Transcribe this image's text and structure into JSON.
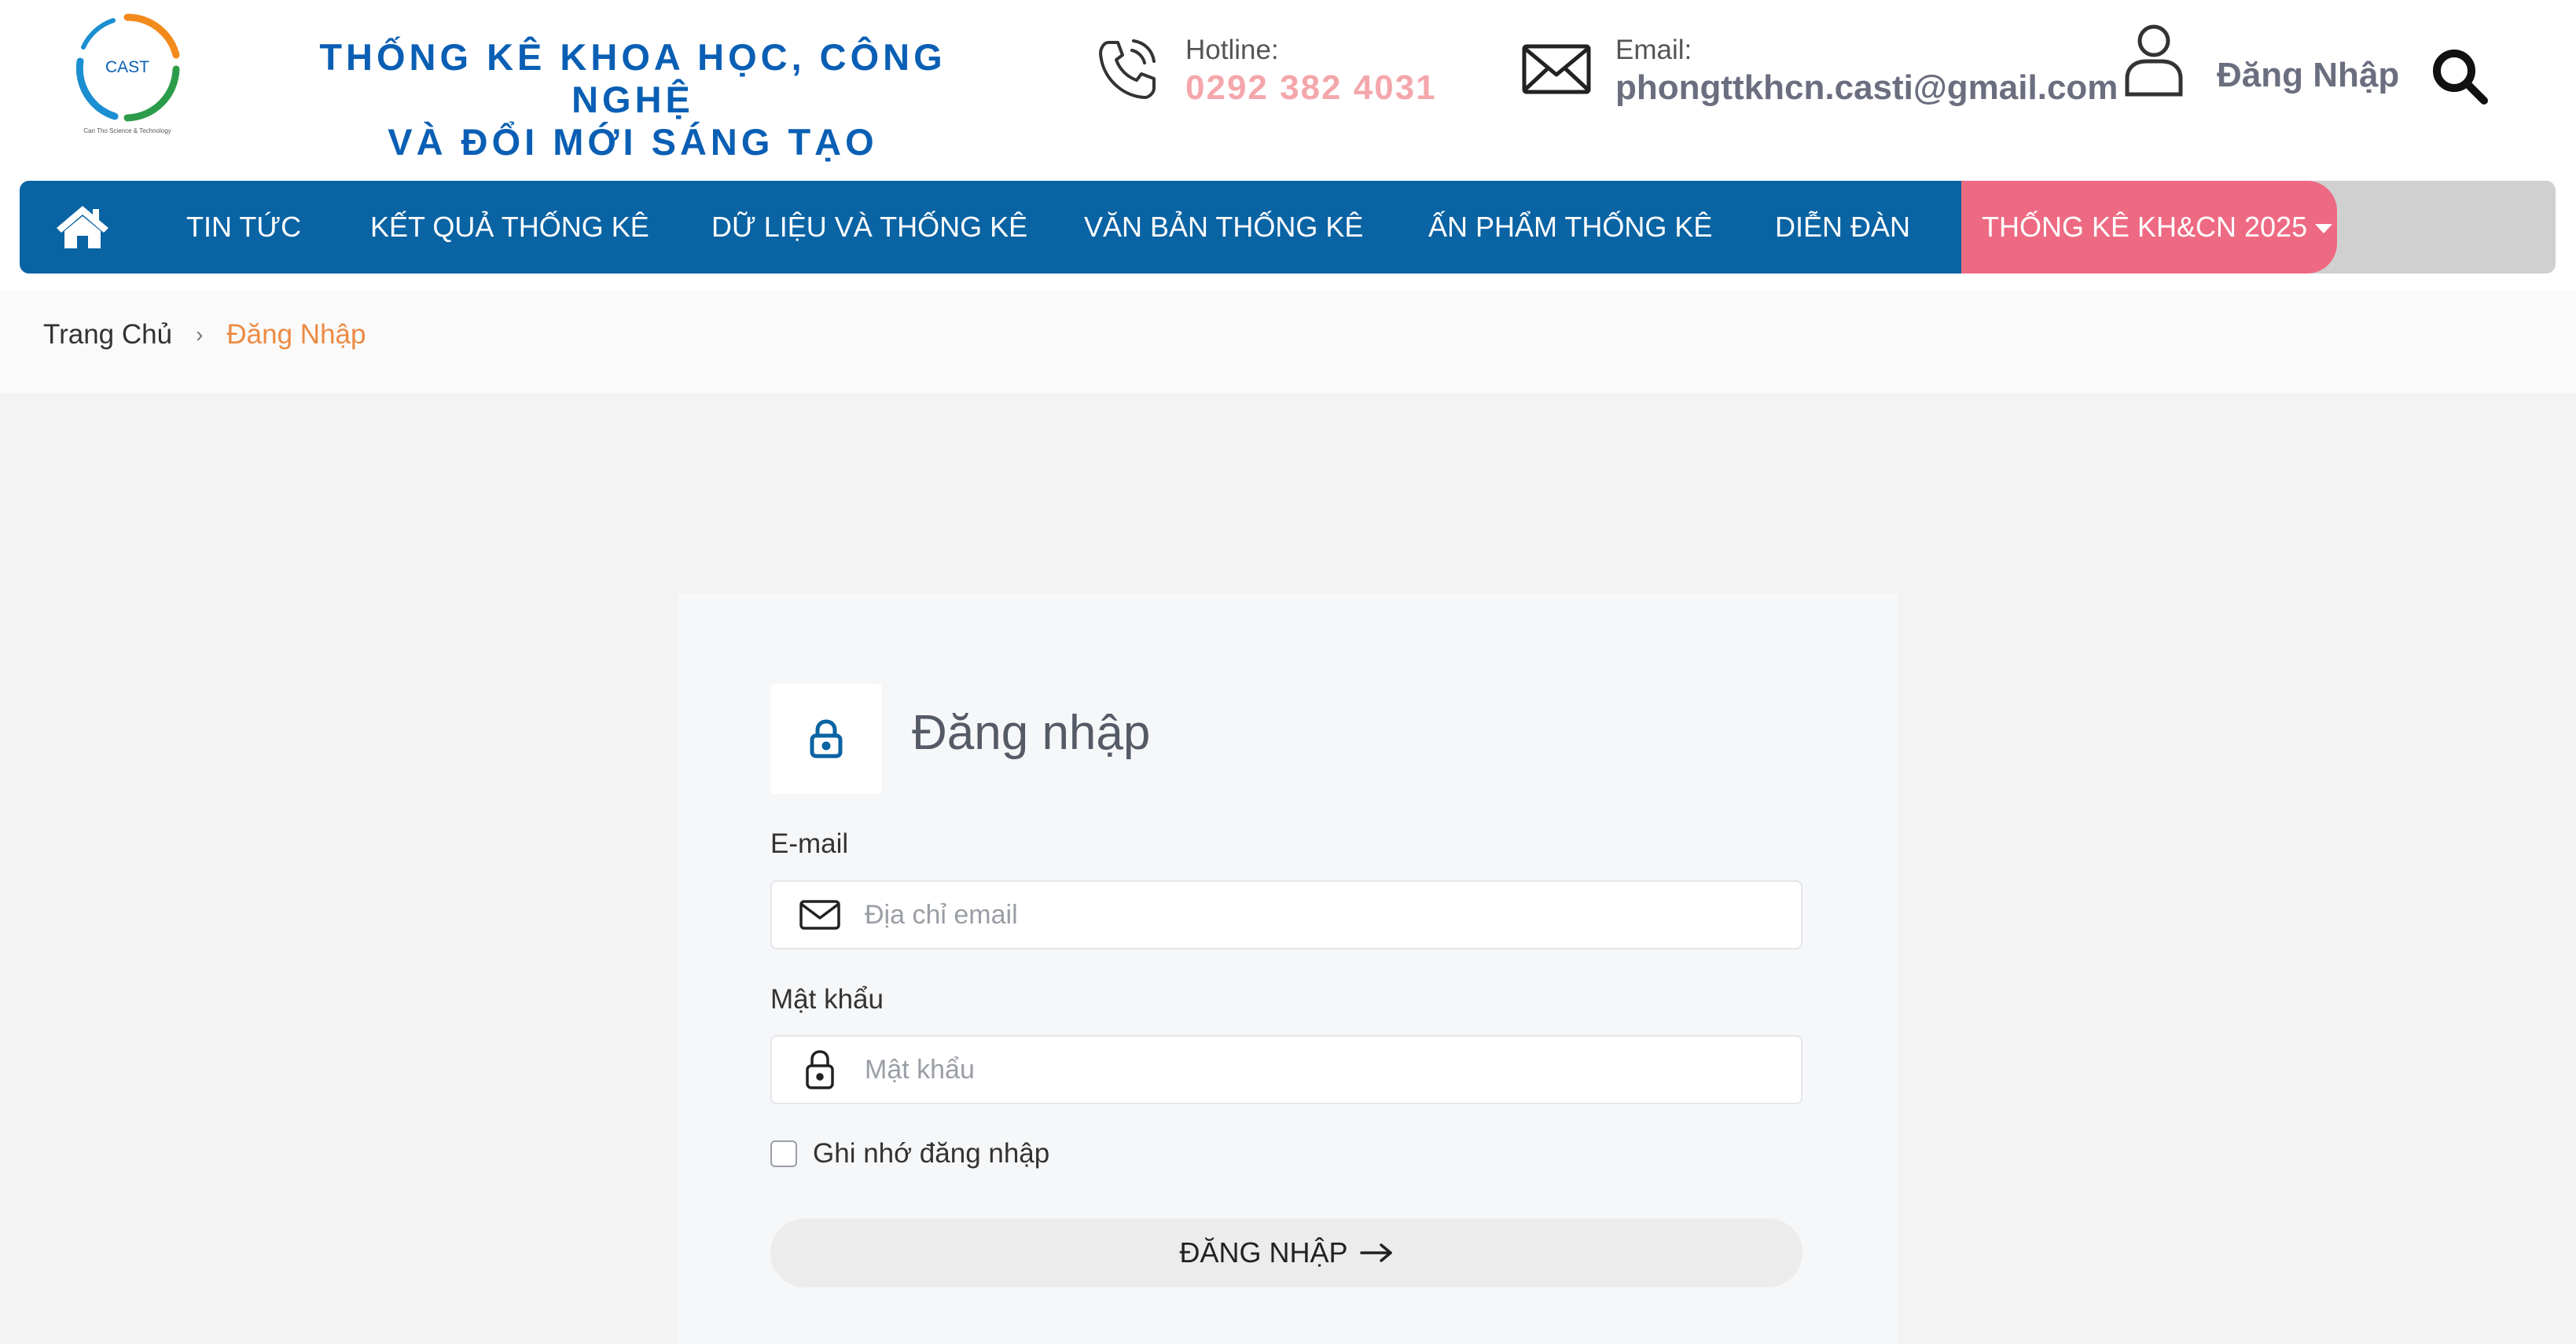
{
  "header": {
    "logo_text": "CAST",
    "logo_tagline": "Can Tho Science & Technology",
    "site_title_line1": "THỐNG KÊ KHOA HỌC, CÔNG NGHỆ",
    "site_title_line2": "VÀ ĐỔI MỚI SÁNG TẠO",
    "hotline_label": "Hotline:",
    "hotline_value": "0292 382 4031",
    "email_label": "Email:",
    "email_value": "phongttkhcn.casti@gmail.com",
    "login_label": "Đăng Nhập"
  },
  "nav": {
    "items": [
      "TIN TỨC",
      "KẾT QUẢ THỐNG KÊ",
      "DỮ LIỆU VÀ THỐNG KÊ",
      "VĂN BẢN THỐNG KÊ",
      "ẤN PHẨM THỐNG KÊ",
      "DIỄN ĐÀN"
    ],
    "special": "THỐNG KÊ KH&CN 2025"
  },
  "breadcrumb": {
    "home": "Trang Chủ",
    "separator": "›",
    "current": "Đăng Nhập"
  },
  "form": {
    "title": "Đăng nhập",
    "email_label": "E-mail",
    "email_placeholder": "Địa chỉ email",
    "password_label": "Mật khẩu",
    "password_placeholder": "Mật khẩu",
    "remember_label": "Ghi nhớ đăng nhập",
    "submit_label": "ĐĂNG NHẬP"
  },
  "colors": {
    "primary": "#0a63a3",
    "title_blue": "#0a5fb4",
    "accent_pink": "#ee6a83",
    "hotline": "#f4a7ab",
    "breadcrumb_active": "#ec8a43"
  },
  "icons": [
    "phone-icon",
    "mail-icon",
    "user-icon",
    "search-icon",
    "home-icon",
    "lock-icon",
    "envelope-icon",
    "arrow-right-icon"
  ]
}
